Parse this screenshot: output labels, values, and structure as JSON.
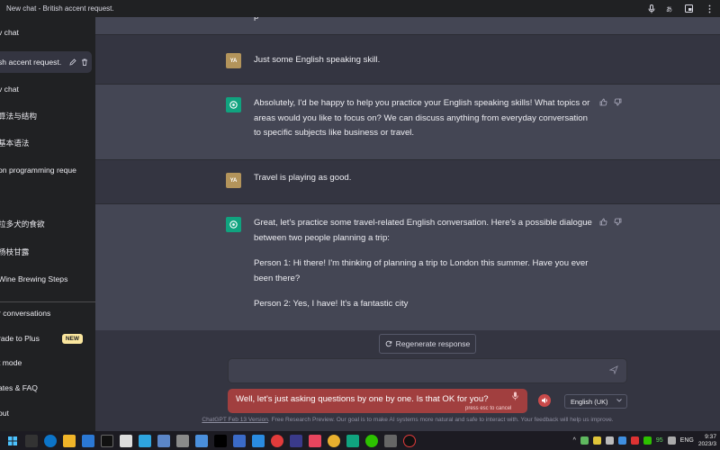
{
  "window": {
    "title": "New chat - British accent request.",
    "buttons": [
      "mic-icon",
      "translate-icon",
      "picture-in-picture-icon",
      "more-icon"
    ]
  },
  "sidebar": {
    "items": [
      {
        "label": "v chat",
        "icon": "plus-icon"
      },
      {
        "label": "sh accent request.",
        "active": true
      },
      {
        "label": "v chat"
      },
      {
        "label": "算法与结构"
      },
      {
        "label": "基本语法"
      },
      {
        "label": "on programming reque"
      },
      {
        "label": "拉多犬的食欲"
      },
      {
        "label": "杨枝甘露"
      },
      {
        "label": " Wine Brewing Steps"
      }
    ],
    "bottom": [
      {
        "label": "r conversations"
      },
      {
        "label": "rade to Plus",
        "badge": "NEW"
      },
      {
        "label": "t mode"
      },
      {
        "label": "ates & FAQ"
      },
      {
        "label": "out"
      }
    ]
  },
  "conversation": {
    "top_fragment": "p",
    "messages": [
      {
        "role": "user",
        "avatar": "YA",
        "text": "Just some English speaking skill."
      },
      {
        "role": "assistant",
        "avatar": "gpt-logo-icon",
        "paragraphs": [
          "Absolutely, I'd be happy to help you practice your English speaking skills! What topics or areas would you like to focus on? We can discuss anything from everyday conversation to specific subjects like business or travel."
        ]
      },
      {
        "role": "user",
        "avatar": "YA",
        "text": "Travel is playing as good."
      },
      {
        "role": "assistant",
        "avatar": "gpt-logo-icon",
        "paragraphs": [
          "Great, let's practice some travel-related English conversation. Here's a possible dialogue between two people planning a trip:",
          "Person 1: Hi there! I'm thinking of planning a trip to London this summer. Have you ever been there?",
          "Person 2: Yes, I have! It's a fantastic city"
        ]
      }
    ]
  },
  "composer": {
    "regenerate_label": "Regenerate response",
    "input_value": "",
    "voice_text": "Well, let's just asking questions by one by one. Is that OK for you?",
    "voice_hint": "press esc to cancel",
    "language": "English (UK)"
  },
  "footer": {
    "link": "ChatGPT Feb 13 Version",
    "text": ". Free Research Preview. Our goal is to make AI systems more natural and safe to interact with. Your feedback will help us improve."
  },
  "taskbar": {
    "lang": "ENG",
    "battery": "95",
    "time": "9:37",
    "date": "2023/3"
  },
  "colors": {
    "sidebar_bg": "#202123",
    "main_bg": "#343541",
    "assistant_bg": "#444654",
    "accent": "#10a37f",
    "user_avatar": "#b3945b",
    "voice_bubble": "#a13f3f"
  }
}
